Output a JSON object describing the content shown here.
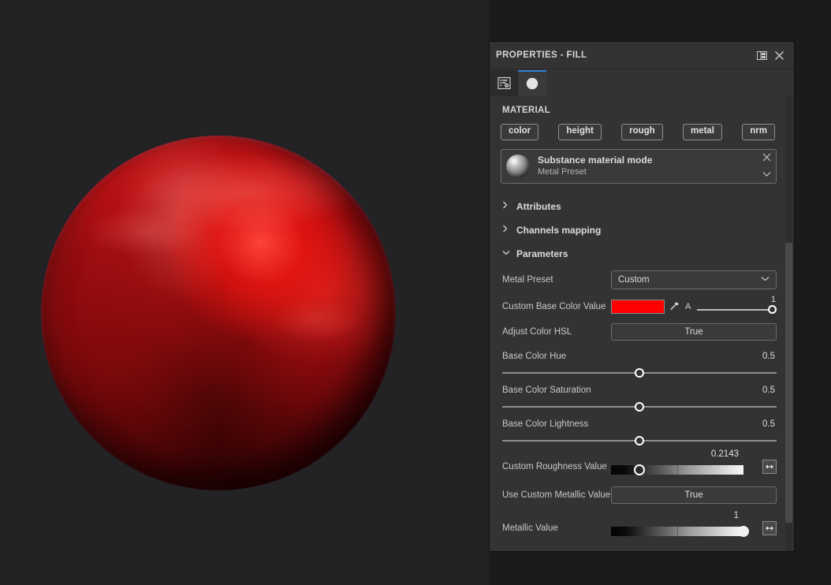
{
  "app": {
    "viewport": {
      "name": "3d-viewport",
      "object": "sphere",
      "material_color": "#d4121a"
    }
  },
  "panel": {
    "title": "PROPERTIES - FILL",
    "header_buttons": [
      {
        "name": "dock-layout-icon",
        "label": ""
      },
      {
        "name": "close-icon",
        "label": ""
      }
    ],
    "tabs": [
      {
        "name": "tab-settings",
        "icon": "settings-list-icon",
        "active": false
      },
      {
        "name": "tab-material",
        "icon": "sphere-material-icon",
        "active": true
      }
    ],
    "section_label": "MATERIAL",
    "channels": [
      {
        "label": "color"
      },
      {
        "label": "height"
      },
      {
        "label": "rough"
      },
      {
        "label": "metal"
      },
      {
        "label": "nrm"
      }
    ],
    "material_card": {
      "name": "Substance material mode",
      "preset": "Metal Preset",
      "remove_icon": "close-icon",
      "expand_icon": "chevron-down-icon"
    },
    "accordions": [
      {
        "label": "Attributes",
        "expanded": false,
        "icon": "chevron-right-icon"
      },
      {
        "label": "Channels mapping",
        "expanded": false,
        "icon": "chevron-right-icon"
      },
      {
        "label": "Parameters",
        "expanded": true,
        "icon": "chevron-down-icon"
      }
    ],
    "parameters": {
      "metal_preset": {
        "label": "Metal Preset",
        "value": "Custom"
      },
      "custom_base_color": {
        "label": "Custom Base Color Value",
        "swatch_color": "#FF0000",
        "eyedropper_icon": "eyedropper-icon",
        "alpha_label": "A",
        "alpha_value": "1",
        "alpha_percent": 100
      },
      "adjust_color_hsl": {
        "label": "Adjust Color HSL",
        "value": "True"
      },
      "base_color_hue": {
        "label": "Base Color Hue",
        "value": "0.5",
        "percent": 50
      },
      "base_color_saturation": {
        "label": "Base Color Saturation",
        "value": "0.5",
        "percent": 50
      },
      "base_color_lightness": {
        "label": "Base Color Lightness",
        "value": "0.5",
        "percent": 50
      },
      "custom_roughness": {
        "label": "Custom Roughness Value",
        "value": "0.2143",
        "percent": 21.43,
        "button_icon": "expand-arrows-icon"
      },
      "use_custom_metallic": {
        "label": "Use Custom Metallic Value",
        "value": "True"
      },
      "metallic_value": {
        "label": "Metallic Value",
        "value": "1",
        "percent": 100,
        "button_icon": "expand-arrows-icon"
      }
    }
  }
}
